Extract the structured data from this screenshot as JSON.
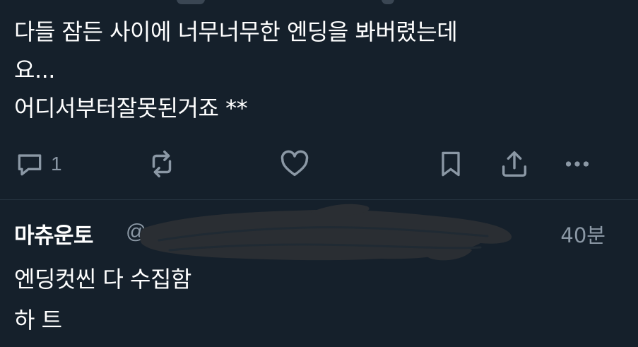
{
  "tweet": {
    "text_lines": [
      "다들 잠든 사이에 너무너무한 엔딩을 봐버렸는데",
      "요...",
      "어디서부터잘못된거죠 **"
    ]
  },
  "actions": {
    "reply": {
      "icon": "reply-icon",
      "count": "1"
    },
    "retweet": {
      "icon": "retweet-icon"
    },
    "like": {
      "icon": "heart-icon"
    },
    "bookmark": {
      "icon": "bookmark-icon"
    },
    "share": {
      "icon": "share-icon"
    },
    "more": {
      "icon": "more-icon"
    }
  },
  "reply": {
    "display_name": "마츄운토",
    "handle_prefix": "@",
    "time": "40분",
    "text_lines": [
      "엔딩컷씬 다 수집함",
      "하 트"
    ]
  },
  "colors": {
    "background": "#15202b",
    "text": "#ffffff",
    "muted": "#8b98a5",
    "redaction": "#2a2e33"
  }
}
